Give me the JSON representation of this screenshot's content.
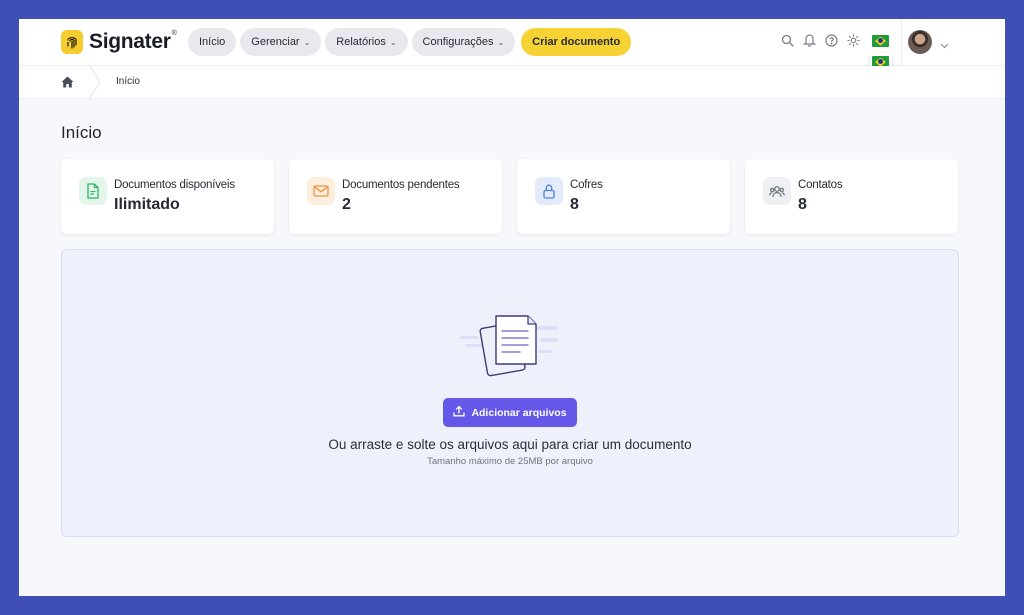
{
  "app": {
    "name": "Signater",
    "trademark": "®"
  },
  "nav": {
    "items": [
      {
        "label": "Início",
        "has_dropdown": false
      },
      {
        "label": "Gerenciar",
        "has_dropdown": true
      },
      {
        "label": "Relatórios",
        "has_dropdown": true
      },
      {
        "label": "Configurações",
        "has_dropdown": true
      }
    ],
    "cta_label": "Criar documento",
    "icons": [
      "search-icon",
      "bell-icon",
      "help-icon",
      "theme-sun-icon"
    ],
    "language": {
      "current": "pt-BR",
      "options": [
        "pt-BR",
        "en-US"
      ]
    }
  },
  "breadcrumb": {
    "items": [
      "Início"
    ]
  },
  "page": {
    "title": "Início"
  },
  "stats": [
    {
      "label": "Documentos disponíveis",
      "value": "Ilimitado",
      "icon": "document-icon",
      "color": "#2fb36a",
      "bg": "#e4f6ea"
    },
    {
      "label": "Documentos pendentes",
      "value": "2",
      "icon": "mail-icon",
      "color": "#f0913c",
      "bg": "#fdeedd"
    },
    {
      "label": "Cofres",
      "value": "8",
      "icon": "lock-icon",
      "color": "#4b7fe0",
      "bg": "#e3ebfb"
    },
    {
      "label": "Contatos",
      "value": "8",
      "icon": "users-icon",
      "color": "#6b6f7c",
      "bg": "#eef0f4"
    }
  ],
  "dropzone": {
    "button_label": "Adicionar arquivos",
    "main_text": "Ou arraste e solte os arquivos aqui para criar um documento",
    "sub_text": "Tamanho máximo de 25MB por arquivo"
  },
  "colors": {
    "accent": "#6558e8",
    "brand": "#f6d232",
    "frame": "#3f4fb6"
  }
}
